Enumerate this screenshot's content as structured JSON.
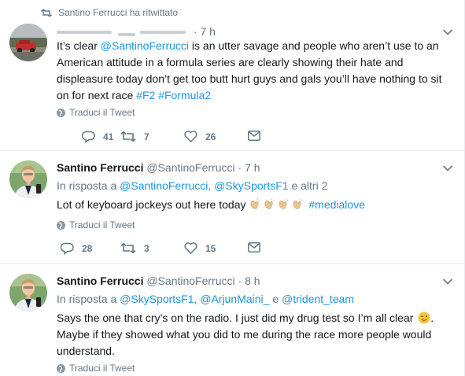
{
  "retweet_context": {
    "text": "Santino Ferrucci ha ritwittato",
    "icon": "retweet-icon"
  },
  "tweets": [
    {
      "time": "7 h",
      "text_parts": [
        "It’s clear ",
        "@SantinoFerrucci",
        " is an utter savage and people who aren’t use to an American attitude in a formula series are clearly showing their hate and displeasure today don’t get too butt hurt guys and gals you’ll have nothing to sit on for next race ",
        "#F2",
        " ",
        "#Formula2"
      ],
      "translate_label": "Traduci il Tweet",
      "stats": {
        "replies": "41",
        "retweets": "7",
        "likes": "26"
      }
    },
    {
      "name": "Santino Ferrucci",
      "handle": "@SantinoFerrucci",
      "separator": "·",
      "time": "7 h",
      "reply_parts": [
        "In risposta a ",
        "@SantinoFerrucci",
        ", ",
        "@SkySportsF1",
        " e altri 2"
      ],
      "text_parts": [
        "Lot of keyboard jockeys out here today ",
        "#medialove"
      ],
      "translate_label": "Traduci il Tweet",
      "stats": {
        "replies": "28",
        "retweets": "3",
        "likes": "15"
      }
    },
    {
      "name": "Santino Ferrucci",
      "handle": "@SantinoFerrucci",
      "separator": "·",
      "time": "8 h",
      "reply_parts": [
        "In risposta a ",
        "@SkySportsF1",
        ", ",
        "@ArjunMaini_",
        " e ",
        "@trident_team"
      ],
      "text_line1": "Says the one that cry’s on the radio. I just did my drug test so I’m all clear",
      "text_line2": ". Maybe if they showed what you did to me during the race more people would understand.",
      "translate_label": "Traduci il Tweet"
    }
  ],
  "colors": {
    "link": "#1b95e0",
    "muted": "#657786",
    "text": "#14171a",
    "border": "#e6ecf0"
  }
}
